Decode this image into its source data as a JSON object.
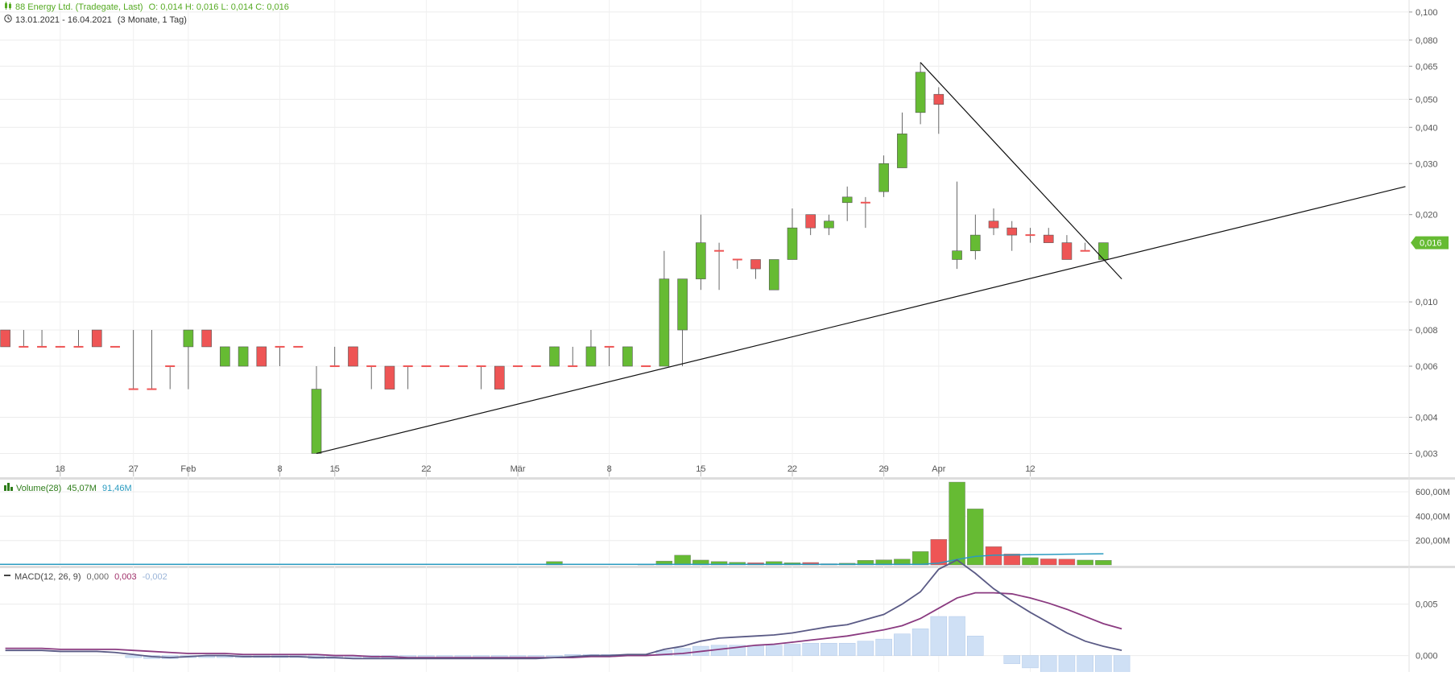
{
  "header": {
    "instrument": "88 Energy Ltd. (Tradegate, Last)",
    "ohlc": "O: 0,014  H: 0,016  L: 0,014  C: 0,016",
    "date_range": "13.01.2021 - 16.04.2021",
    "period": "(3 Monate, 1 Tag)"
  },
  "volume_legend": {
    "label": "Volume(28)",
    "value1": "45,07M",
    "value2": "91,46M"
  },
  "macd_legend": {
    "label": "MACD(12, 26, 9)",
    "value1": "0,000",
    "value2": "0,003",
    "value3": "-0,002"
  },
  "last_price_label": "0,016",
  "colors": {
    "up": "#66bb33",
    "down": "#ee5555",
    "volume_ma": "#2a9bc0",
    "macd": "#5a5a85",
    "signal": "#8a3a80",
    "histogram": "#cfe0f5"
  },
  "chart_data": [
    {
      "type": "candlestick",
      "title": "88 Energy Ltd. (Tradegate, Last)",
      "y_scale": "log",
      "ylim": [
        0.0025,
        0.11
      ],
      "y_ticks": [
        "0,003",
        "0,004",
        "0,006",
        "0,008",
        "0,010",
        "0,016",
        "0,020",
        "0,030",
        "0,040",
        "0,050",
        "0,065",
        "0,080",
        "0,100"
      ],
      "x_tick_labels": [
        {
          "index": 3,
          "label": "18"
        },
        {
          "index": 7,
          "label": "27"
        },
        {
          "index": 10,
          "label": "Feb"
        },
        {
          "index": 15,
          "label": "8"
        },
        {
          "index": 18,
          "label": "15"
        },
        {
          "index": 23,
          "label": "22"
        },
        {
          "index": 28,
          "label": "Mär"
        },
        {
          "index": 33,
          "label": "8"
        },
        {
          "index": 38,
          "label": "15"
        },
        {
          "index": 43,
          "label": "22"
        },
        {
          "index": 48,
          "label": "29"
        },
        {
          "index": 51,
          "label": "Apr"
        },
        {
          "index": 56,
          "label": "12"
        }
      ],
      "candles": [
        {
          "o": 0.008,
          "h": 0.008,
          "l": 0.008,
          "c": 0.007
        },
        {
          "o": 0.007,
          "h": 0.008,
          "l": 0.007,
          "c": 0.007
        },
        {
          "o": 0.007,
          "h": 0.008,
          "l": 0.007,
          "c": 0.007
        },
        {
          "o": 0.007,
          "h": 0.007,
          "l": 0.007,
          "c": 0.007
        },
        {
          "o": 0.007,
          "h": 0.008,
          "l": 0.007,
          "c": 0.007
        },
        {
          "o": 0.008,
          "h": 0.008,
          "l": 0.007,
          "c": 0.007
        },
        {
          "o": 0.007,
          "h": 0.007,
          "l": 0.007,
          "c": 0.007
        },
        {
          "o": 0.005,
          "h": 0.008,
          "l": 0.005,
          "c": 0.005
        },
        {
          "o": 0.005,
          "h": 0.008,
          "l": 0.005,
          "c": 0.005
        },
        {
          "o": 0.006,
          "h": 0.006,
          "l": 0.005,
          "c": 0.006
        },
        {
          "o": 0.007,
          "h": 0.008,
          "l": 0.005,
          "c": 0.008
        },
        {
          "o": 0.008,
          "h": 0.008,
          "l": 0.007,
          "c": 0.007
        },
        {
          "o": 0.006,
          "h": 0.007,
          "l": 0.006,
          "c": 0.007
        },
        {
          "o": 0.006,
          "h": 0.007,
          "l": 0.006,
          "c": 0.007
        },
        {
          "o": 0.007,
          "h": 0.007,
          "l": 0.006,
          "c": 0.006
        },
        {
          "o": 0.007,
          "h": 0.007,
          "l": 0.006,
          "c": 0.007
        },
        {
          "o": 0.007,
          "h": 0.007,
          "l": 0.007,
          "c": 0.007
        },
        {
          "o": 0.003,
          "h": 0.006,
          "l": 0.003,
          "c": 0.005
        },
        {
          "o": 0.006,
          "h": 0.007,
          "l": 0.006,
          "c": 0.006
        },
        {
          "o": 0.007,
          "h": 0.007,
          "l": 0.006,
          "c": 0.006
        },
        {
          "o": 0.006,
          "h": 0.006,
          "l": 0.005,
          "c": 0.006
        },
        {
          "o": 0.006,
          "h": 0.006,
          "l": 0.005,
          "c": 0.005
        },
        {
          "o": 0.006,
          "h": 0.006,
          "l": 0.005,
          "c": 0.006
        },
        {
          "o": 0.006,
          "h": 0.006,
          "l": 0.006,
          "c": 0.006
        },
        {
          "o": 0.006,
          "h": 0.006,
          "l": 0.006,
          "c": 0.006
        },
        {
          "o": 0.006,
          "h": 0.006,
          "l": 0.006,
          "c": 0.006
        },
        {
          "o": 0.006,
          "h": 0.006,
          "l": 0.005,
          "c": 0.006
        },
        {
          "o": 0.006,
          "h": 0.006,
          "l": 0.005,
          "c": 0.005
        },
        {
          "o": 0.006,
          "h": 0.006,
          "l": 0.006,
          "c": 0.006
        },
        {
          "o": 0.006,
          "h": 0.006,
          "l": 0.006,
          "c": 0.006
        },
        {
          "o": 0.006,
          "h": 0.007,
          "l": 0.006,
          "c": 0.007
        },
        {
          "o": 0.006,
          "h": 0.007,
          "l": 0.006,
          "c": 0.006
        },
        {
          "o": 0.006,
          "h": 0.008,
          "l": 0.006,
          "c": 0.007
        },
        {
          "o": 0.007,
          "h": 0.007,
          "l": 0.006,
          "c": 0.007
        },
        {
          "o": 0.006,
          "h": 0.007,
          "l": 0.006,
          "c": 0.007
        },
        {
          "o": 0.006,
          "h": 0.006,
          "l": 0.006,
          "c": 0.006
        },
        {
          "o": 0.006,
          "h": 0.015,
          "l": 0.006,
          "c": 0.012
        },
        {
          "o": 0.008,
          "h": 0.012,
          "l": 0.006,
          "c": 0.012
        },
        {
          "o": 0.012,
          "h": 0.02,
          "l": 0.011,
          "c": 0.016
        },
        {
          "o": 0.015,
          "h": 0.016,
          "l": 0.011,
          "c": 0.015
        },
        {
          "o": 0.014,
          "h": 0.014,
          "l": 0.013,
          "c": 0.014
        },
        {
          "o": 0.014,
          "h": 0.014,
          "l": 0.012,
          "c": 0.013
        },
        {
          "o": 0.011,
          "h": 0.014,
          "l": 0.011,
          "c": 0.014
        },
        {
          "o": 0.014,
          "h": 0.021,
          "l": 0.014,
          "c": 0.018
        },
        {
          "o": 0.02,
          "h": 0.02,
          "l": 0.017,
          "c": 0.018
        },
        {
          "o": 0.018,
          "h": 0.02,
          "l": 0.017,
          "c": 0.019
        },
        {
          "o": 0.022,
          "h": 0.025,
          "l": 0.019,
          "c": 0.023
        },
        {
          "o": 0.022,
          "h": 0.023,
          "l": 0.018,
          "c": 0.022
        },
        {
          "o": 0.024,
          "h": 0.032,
          "l": 0.023,
          "c": 0.03
        },
        {
          "o": 0.029,
          "h": 0.045,
          "l": 0.029,
          "c": 0.038
        },
        {
          "o": 0.045,
          "h": 0.067,
          "l": 0.041,
          "c": 0.062
        },
        {
          "o": 0.052,
          "h": 0.055,
          "l": 0.038,
          "c": 0.048
        },
        {
          "o": 0.014,
          "h": 0.026,
          "l": 0.013,
          "c": 0.015
        },
        {
          "o": 0.015,
          "h": 0.02,
          "l": 0.014,
          "c": 0.017
        },
        {
          "o": 0.019,
          "h": 0.021,
          "l": 0.017,
          "c": 0.018
        },
        {
          "o": 0.018,
          "h": 0.019,
          "l": 0.015,
          "c": 0.017
        },
        {
          "o": 0.017,
          "h": 0.018,
          "l": 0.016,
          "c": 0.017
        },
        {
          "o": 0.017,
          "h": 0.018,
          "l": 0.016,
          "c": 0.016
        },
        {
          "o": 0.016,
          "h": 0.017,
          "l": 0.014,
          "c": 0.014
        },
        {
          "o": 0.015,
          "h": 0.016,
          "l": 0.015,
          "c": 0.015
        },
        {
          "o": 0.014,
          "h": 0.016,
          "l": 0.014,
          "c": 0.016
        }
      ],
      "trendlines": [
        {
          "from": {
            "index": 17,
            "price": 0.003
          },
          "to": {
            "index": 76.5,
            "price": 0.025
          }
        },
        {
          "from": {
            "index": 50,
            "price": 0.067
          },
          "to": {
            "index": 61,
            "price": 0.012
          }
        }
      ]
    },
    {
      "type": "bar",
      "title": "Volume(28)",
      "ylim": [
        0,
        700
      ],
      "y_ticks": [
        "200,00M",
        "400,00M",
        "600,00M"
      ],
      "unit": "M",
      "values": [
        0,
        0,
        0,
        0,
        0,
        0,
        0,
        0,
        0,
        0,
        0,
        0,
        0,
        0,
        0,
        0,
        0,
        0,
        0,
        0,
        0,
        0,
        0,
        0,
        0,
        0,
        0,
        0,
        0,
        0,
        28,
        0,
        0,
        0,
        0,
        6,
        32,
        80,
        40,
        28,
        22,
        18,
        28,
        18,
        20,
        10,
        14,
        38,
        42,
        48,
        110,
        210,
        680,
        460,
        150,
        90,
        60,
        50,
        48,
        40,
        38
      ],
      "ma_values": [
        5,
        5,
        5,
        5,
        5,
        5,
        5,
        5,
        5,
        5,
        5,
        5,
        5,
        5,
        5,
        5,
        5,
        5,
        5,
        5,
        5,
        5,
        5,
        5,
        5,
        5,
        5,
        5,
        5,
        5,
        5,
        5,
        5,
        5,
        5,
        5,
        5,
        5,
        5,
        5,
        5,
        5,
        5,
        5,
        5,
        5,
        5,
        5,
        5,
        5,
        5,
        15,
        45,
        70,
        80,
        82,
        84,
        86,
        88,
        90,
        91.46
      ]
    },
    {
      "type": "line",
      "title": "MACD(12, 26, 9)",
      "ylim": [
        -0.0016,
        0.0085
      ],
      "y_ticks": [
        "0,000",
        "0,005"
      ],
      "macd": [
        0.0005,
        0.0005,
        0.0005,
        0.0004,
        0.0004,
        0.0004,
        0.0003,
        0.0001,
        -0.0001,
        -0.0002,
        -0.0001,
        0.0,
        0.0,
        -0.0001,
        -0.0001,
        -0.0001,
        -0.0001,
        -0.0002,
        -0.0002,
        -0.0003,
        -0.0003,
        -0.0003,
        -0.0003,
        -0.0003,
        -0.0003,
        -0.0003,
        -0.0003,
        -0.0003,
        -0.0003,
        -0.0003,
        -0.0002,
        -0.0001,
        0.0,
        0.0,
        0.0001,
        0.0001,
        0.0006,
        0.0009,
        0.0014,
        0.0017,
        0.0018,
        0.0019,
        0.002,
        0.0022,
        0.0025,
        0.0028,
        0.003,
        0.0035,
        0.004,
        0.005,
        0.0062,
        0.0084,
        0.0093,
        0.008,
        0.0065,
        0.0053,
        0.0042,
        0.0032,
        0.0022,
        0.0014,
        0.0009,
        0.0005
      ],
      "signal": [
        0.0007,
        0.0007,
        0.0007,
        0.0006,
        0.0006,
        0.0006,
        0.0006,
        0.0005,
        0.0004,
        0.0003,
        0.0002,
        0.0002,
        0.0002,
        0.0001,
        0.0001,
        0.0001,
        0.0001,
        0.0001,
        0.0,
        0.0,
        -0.0001,
        -0.0001,
        -0.0002,
        -0.0002,
        -0.0002,
        -0.0002,
        -0.0002,
        -0.0002,
        -0.0002,
        -0.0002,
        -0.0002,
        -0.0002,
        -0.0001,
        -0.0001,
        0.0,
        0.0,
        0.0001,
        0.0002,
        0.0004,
        0.0006,
        0.0008,
        0.001,
        0.0011,
        0.0013,
        0.0015,
        0.0017,
        0.0019,
        0.0022,
        0.0025,
        0.0029,
        0.0036,
        0.0046,
        0.0056,
        0.0061,
        0.0061,
        0.006,
        0.0056,
        0.0051,
        0.0045,
        0.0038,
        0.0031,
        0.0026
      ],
      "histogram": [
        0,
        0,
        0,
        0,
        0,
        0,
        0,
        -0.0002,
        -0.0003,
        -0.0003,
        -0.0002,
        -0.0002,
        -0.0002,
        -0.0002,
        -0.0002,
        -0.0002,
        -0.0002,
        -0.0003,
        -0.0003,
        -0.0003,
        -0.0002,
        -0.0002,
        -0.0002,
        -0.0002,
        -0.0002,
        -0.0002,
        -0.0002,
        -0.0002,
        -0.0002,
        -0.0002,
        -0.0001,
        0.0001,
        0.0001,
        0.0001,
        0.0001,
        0.0001,
        0.0005,
        0.0007,
        0.0009,
        0.001,
        0.001,
        0.001,
        0.001,
        0.0011,
        0.0012,
        0.0012,
        0.0012,
        0.0014,
        0.0016,
        0.0021,
        0.0026,
        0.0038,
        0.0038,
        0.0019,
        -0.0,
        -0.0008,
        -0.0012,
        -0.0018,
        -0.0022,
        -0.0025,
        -0.0024,
        -0.0021
      ]
    }
  ]
}
